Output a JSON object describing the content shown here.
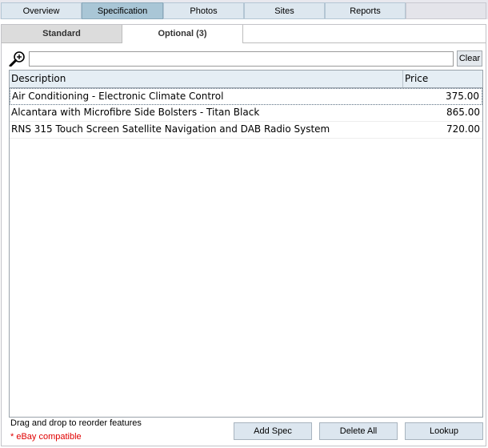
{
  "top_tabs": [
    {
      "label": "Overview",
      "active": false
    },
    {
      "label": "Specification",
      "active": true
    },
    {
      "label": "Photos",
      "active": false
    },
    {
      "label": "Sites",
      "active": false
    },
    {
      "label": "Reports",
      "active": false
    }
  ],
  "sub_tabs": [
    {
      "label": "Standard",
      "active": false
    },
    {
      "label": "Optional (3)",
      "active": true
    }
  ],
  "search": {
    "value": "",
    "placeholder": "",
    "clear_label": "Clear",
    "icon": "zoom-in-magnifier-icon"
  },
  "table": {
    "columns": [
      "Description",
      "Price"
    ],
    "rows": [
      {
        "description": "Air Conditioning - Electronic Climate Control",
        "price": "375.00",
        "selected": true
      },
      {
        "description": "Alcantara with Microfibre Side Bolsters - Titan Black",
        "price": "865.00",
        "selected": false
      },
      {
        "description": "RNS 315 Touch Screen Satellite Navigation and DAB Radio System",
        "price": "720.00",
        "selected": false
      }
    ]
  },
  "footer": {
    "drag_hint": "Drag and drop to reorder features",
    "ebay_note": "* eBay compatible",
    "add_spec": "Add Spec",
    "delete_all": "Delete All",
    "lookup": "Lookup"
  },
  "colors": {
    "active_tab": "#a9c6d6",
    "tab": "#dde7ef",
    "ebay_note": "#e00000",
    "header": "#e5eef4"
  }
}
